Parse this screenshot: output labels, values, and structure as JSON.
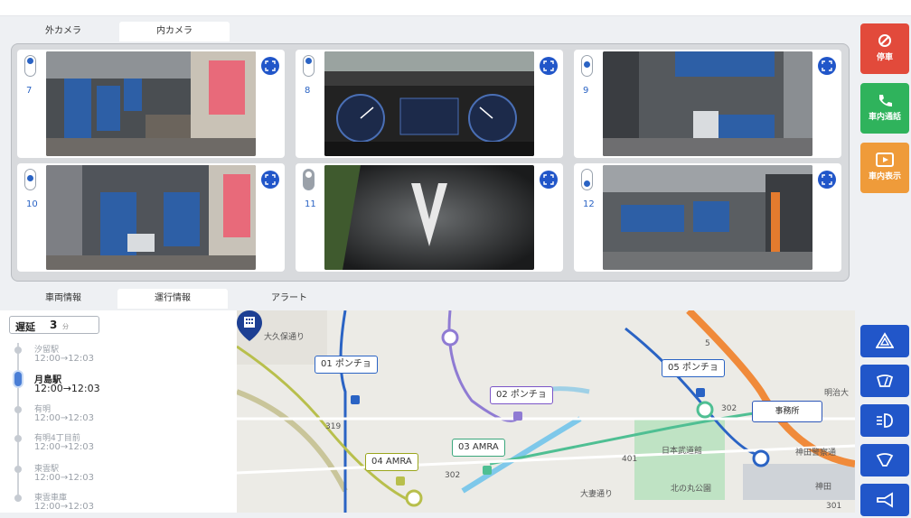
{
  "camera_tabs": [
    {
      "label": "外カメラ",
      "active": false
    },
    {
      "label": "内カメラ",
      "active": true
    }
  ],
  "cameras": [
    {
      "number": "7",
      "toggle": "on",
      "scene": "bus-interior-seats"
    },
    {
      "number": "8",
      "toggle": "on",
      "scene": "dashboard-gauges"
    },
    {
      "number": "9",
      "toggle": "on",
      "scene": "bus-interior-top"
    },
    {
      "number": "10",
      "toggle": "on",
      "scene": "bus-interior-seats"
    },
    {
      "number": "11",
      "toggle": "off",
      "scene": "road-arrow"
    },
    {
      "number": "12",
      "toggle": "on",
      "scene": "bus-interior-top"
    }
  ],
  "info_tabs": [
    {
      "label": "車両情報",
      "active": false
    },
    {
      "label": "運行情報",
      "active": true
    },
    {
      "label": "アラート",
      "active": false
    }
  ],
  "delay": {
    "label": "遅延",
    "value": "3",
    "unit": "分"
  },
  "stops": [
    {
      "name": "汐留駅",
      "time": "12:00→12:03",
      "current": false
    },
    {
      "name": "月島駅",
      "time": "12:00→12:03",
      "current": true
    },
    {
      "name": "有明",
      "time": "12:00→12:03",
      "current": false
    },
    {
      "name": "有明4丁目前",
      "time": "12:00→12:03",
      "current": false
    },
    {
      "name": "東雲駅",
      "time": "12:00→12:03",
      "current": false
    },
    {
      "name": "東雲車庫",
      "time": "12:00→12:03",
      "current": false
    }
  ],
  "map": {
    "buses": [
      {
        "label": "01 ポンチョ",
        "color": "#2a63c4"
      },
      {
        "label": "02 ポンチョ",
        "color": "#7b55c8"
      },
      {
        "label": "03 AMRA",
        "color": "#3aa77c"
      },
      {
        "label": "04 AMRA",
        "color": "#9aa51c"
      },
      {
        "label": "05 ポンチョ",
        "color": "#2a63c4"
      }
    ],
    "office_label": "事務所",
    "place_labels": [
      "大久保通り",
      "日本武道館",
      "北の丸公園",
      "神田警察通",
      "明治大",
      "神田",
      "大妻通り"
    ],
    "road_numbers": [
      "302",
      "302",
      "401",
      "301",
      "5",
      "319"
    ]
  },
  "actions": [
    {
      "label": "停車",
      "icon": "stop-icon",
      "color": "#e24a3b"
    },
    {
      "label": "車内通話",
      "icon": "phone-icon",
      "color": "#2fb35c"
    },
    {
      "label": "車内表示",
      "icon": "display-icon",
      "color": "#ef9b3a"
    }
  ],
  "controls": [
    {
      "icon": "hazard-icon"
    },
    {
      "icon": "wiper-icon"
    },
    {
      "icon": "headlight-icon"
    },
    {
      "icon": "front-wiper-icon"
    },
    {
      "icon": "horn-icon"
    }
  ],
  "colors": {
    "primary": "#2156c9",
    "stop": "#e24a3b",
    "call": "#2fb35c",
    "display": "#ef9b3a"
  }
}
